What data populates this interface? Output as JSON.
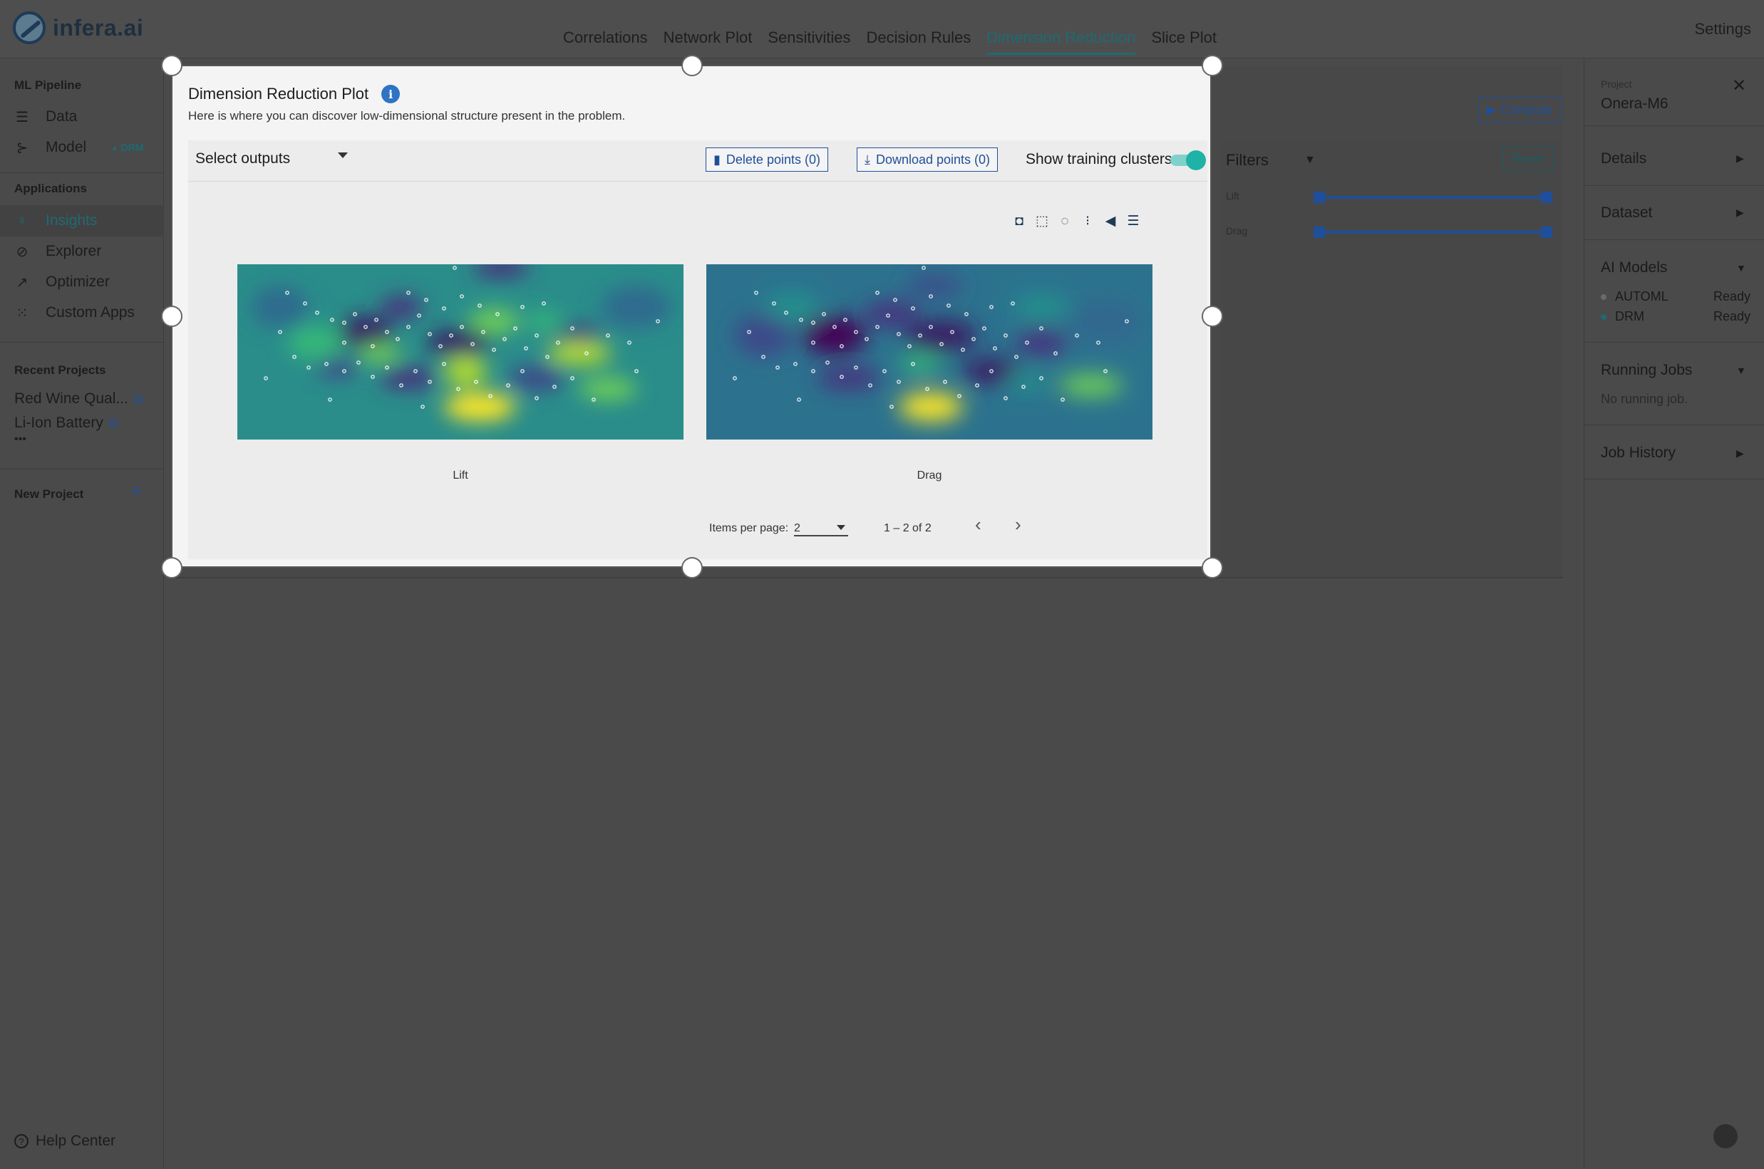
{
  "app": {
    "logo_text": "infera.ai",
    "settings_label": "Settings"
  },
  "nav": {
    "tabs": [
      {
        "label": "Correlations",
        "active": false
      },
      {
        "label": "Network Plot",
        "active": false
      },
      {
        "label": "Sensitivities",
        "active": false
      },
      {
        "label": "Decision Rules",
        "active": false
      },
      {
        "label": "Dimension Reduction",
        "active": true
      },
      {
        "label": "Slice Plot",
        "active": false
      }
    ]
  },
  "sidebar": {
    "pipeline_heading": "ML Pipeline",
    "data_label": "Data",
    "model_label": "Model",
    "model_badge": "DRM",
    "applications_heading": "Applications",
    "insights_label": "Insights",
    "explorer_label": "Explorer",
    "optimizer_label": "Optimizer",
    "custom_apps_label": "Custom Apps",
    "recent_heading": "Recent Projects",
    "recent_1": "Red Wine Qual...",
    "recent_2": "Li-Ion Battery",
    "more": "•••",
    "new_project_label": "New Project",
    "help_label": "Help Center"
  },
  "background": {
    "compute_label": "Compute",
    "filters_label": "Filters",
    "reset_label": "Reset",
    "filter_1": "Lift",
    "filter_2": "Drag"
  },
  "right_panel": {
    "project_caption": "Project",
    "project_name": "Onera-M6",
    "details_label": "Details",
    "dataset_label": "Dataset",
    "ai_models_label": "AI Models",
    "model_1_name": "AUTOML",
    "model_1_status": "Ready",
    "model_2_name": "DRM",
    "model_2_status": "Ready",
    "running_jobs_label": "Running Jobs",
    "no_running": "No running job.",
    "job_history_label": "Job History"
  },
  "modal": {
    "title": "Dimension Reduction Plot",
    "info_glyph": "i",
    "subtitle": "Here is where you can discover low-dimensional structure present in the problem.",
    "select_outputs": "Select outputs",
    "delete_label": "Delete points (0)",
    "download_label": "Download points (0)",
    "show_clusters_label": "Show training clusters",
    "show_clusters_on": true,
    "plot_1_label": "Lift",
    "plot_2_label": "Drag",
    "items_per_page_label": "Items per page:",
    "items_per_page_value": "2",
    "range_label": "1 – 2 of 2"
  },
  "colors": {
    "accent": "#1f6a72",
    "link_blue": "#1f4f9a",
    "toggle": "#1fb2a6",
    "viridis_low": "#440154",
    "viridis_mid": "#21918c",
    "viridis_high": "#fde725"
  }
}
